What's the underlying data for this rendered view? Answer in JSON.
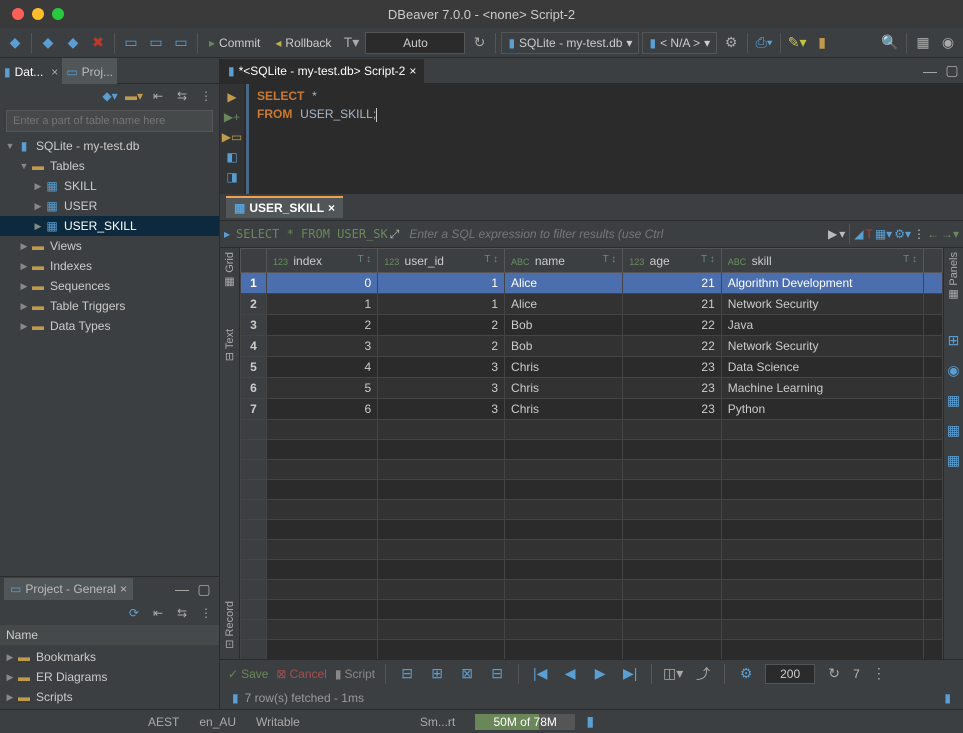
{
  "title": "DBeaver 7.0.0 - <none> Script-2",
  "toolbar": {
    "commit_label": "Commit",
    "rollback_label": "Rollback",
    "mode": "Auto",
    "datasource": "SQLite - my-test.db",
    "catalog": "< N/A >"
  },
  "left_tabs": {
    "database": "Dat...",
    "projects": "Proj..."
  },
  "filter_placeholder": "Enter a part of table name here",
  "db_tree": {
    "connection": "SQLite - my-test.db",
    "tables_label": "Tables",
    "tables": [
      "SKILL",
      "USER",
      "USER_SKILL"
    ],
    "selected": "USER_SKILL",
    "folders": [
      "Views",
      "Indexes",
      "Sequences",
      "Table Triggers",
      "Data Types"
    ]
  },
  "project_panel": {
    "title": "Project - General",
    "header": "Name",
    "items": [
      "Bookmarks",
      "ER Diagrams",
      "Scripts"
    ]
  },
  "editor": {
    "tab": "*<SQLite - my-test.db> Script-2",
    "sql_select": "SELECT",
    "sql_star": "*",
    "sql_from": "FROM",
    "sql_table": "USER_SKILL",
    "sql_end": ";"
  },
  "result": {
    "tab": "USER_SKILL",
    "preview": "SELECT * FROM USER_SK",
    "filter_hint": "Enter a SQL expression to filter results (use Ctrl",
    "columns": [
      {
        "name": "index",
        "type": "123"
      },
      {
        "name": "user_id",
        "type": "123"
      },
      {
        "name": "name",
        "type": "ABC"
      },
      {
        "name": "age",
        "type": "123"
      },
      {
        "name": "skill",
        "type": "ABC"
      }
    ],
    "rows": [
      {
        "n": 1,
        "index": 0,
        "user_id": 1,
        "name": "Alice",
        "age": 21,
        "skill": "Algorithm Development"
      },
      {
        "n": 2,
        "index": 1,
        "user_id": 1,
        "name": "Alice",
        "age": 21,
        "skill": "Network Security"
      },
      {
        "n": 3,
        "index": 2,
        "user_id": 2,
        "name": "Bob",
        "age": 22,
        "skill": "Java"
      },
      {
        "n": 4,
        "index": 3,
        "user_id": 2,
        "name": "Bob",
        "age": 22,
        "skill": "Network Security"
      },
      {
        "n": 5,
        "index": 4,
        "user_id": 3,
        "name": "Chris",
        "age": 23,
        "skill": "Data Science"
      },
      {
        "n": 6,
        "index": 5,
        "user_id": 3,
        "name": "Chris",
        "age": 23,
        "skill": "Machine Learning"
      },
      {
        "n": 7,
        "index": 6,
        "user_id": 3,
        "name": "Chris",
        "age": 23,
        "skill": "Python"
      }
    ],
    "footer": {
      "save": "Save",
      "cancel": "Cancel",
      "script": "Script",
      "page_size": "200",
      "refresh": "7"
    },
    "status": "7 row(s) fetched - 1ms"
  },
  "statusbar": {
    "tz": "AEST",
    "locale": "en_AU",
    "mode": "Writable",
    "ins": "Sm...rt",
    "mem": "50M of 78M"
  }
}
